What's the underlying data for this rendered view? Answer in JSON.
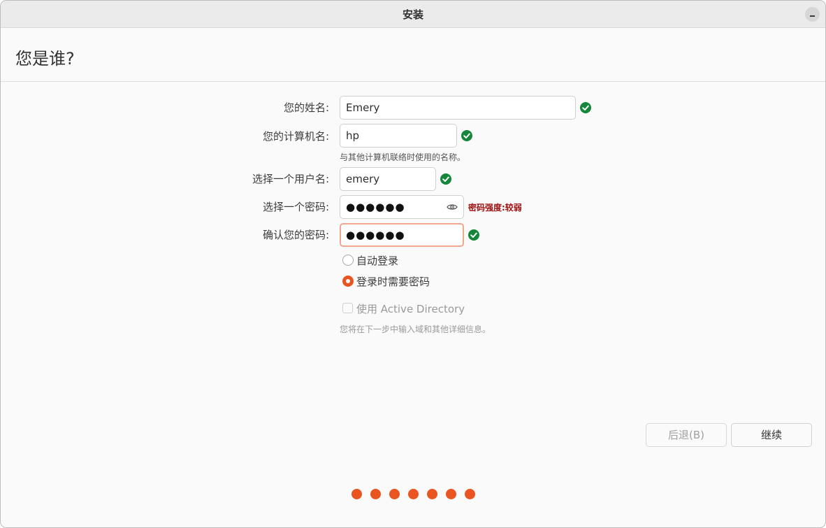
{
  "window": {
    "title": "安装",
    "minimize_label": "–"
  },
  "page": {
    "title": "您是谁?"
  },
  "form": {
    "name": {
      "label": "您的姓名:",
      "value": "Emery"
    },
    "computer": {
      "label": "您的计算机名:",
      "value": "hp",
      "hint": "与其他计算机联络时使用的名称。"
    },
    "username": {
      "label": "选择一个用户名:",
      "value": "emery"
    },
    "password": {
      "label": "选择一个密码:",
      "value": "●●●●●●",
      "strength": "密码强度:较弱"
    },
    "confirm": {
      "label": "确认您的密码:",
      "value": "●●●●●●"
    },
    "login_options": [
      {
        "label": "自动登录",
        "selected": false
      },
      {
        "label": "登录时需要密码",
        "selected": true
      }
    ],
    "active_directory": {
      "label": "使用 Active Directory",
      "checked": false,
      "hint": "您将在下一步中输入域和其他详细信息。"
    }
  },
  "buttons": {
    "back": "后退(B)",
    "continue": "继续"
  },
  "progress": {
    "total_steps": 7,
    "completed_steps": 7
  },
  "colors": {
    "accent": "#e95420",
    "check": "#15863c",
    "weak": "#a01010"
  },
  "icons": {
    "check": "check-circle-icon",
    "eye": "eye-icon"
  }
}
